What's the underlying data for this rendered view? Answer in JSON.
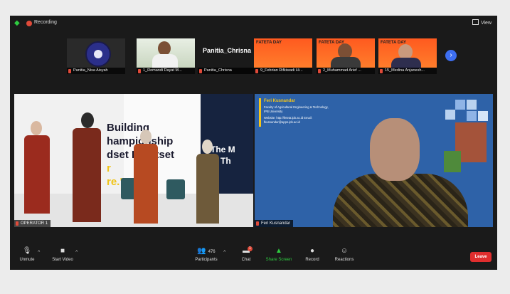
{
  "topbar": {
    "recording_label": "Recording",
    "view_label": "View"
  },
  "thumbnails": [
    {
      "name": "Panitia_Nisa Aisyah"
    },
    {
      "name": "1_Romandi Dayat M..."
    },
    {
      "name": "Panitia_Chrisna",
      "big_label": "Panitia_Chrisna"
    },
    {
      "name": "9_Febrian Rifkiwadi Hi...",
      "banner": "FATETA DAY"
    },
    {
      "name": "2_Muhammad Arief ...",
      "banner": "FATETA DAY"
    },
    {
      "name": "15_Medina Anjanesh...",
      "banner": "FATETA DAY"
    }
  ],
  "panels": {
    "left": {
      "name": "OPERATOR 1",
      "wall_line1": "Building",
      "wall_line2": "hampionship",
      "wall_line3": "dset Heartset",
      "wall_line4": "r",
      "wall_line5": "re.\"",
      "dark_wall_line1": "The M",
      "dark_wall_line2": "in Th"
    },
    "right": {
      "name": "Feri Kusnandar",
      "card_title": "Feri Kusnandar",
      "card_affiliation": "Faculty of Agricultural Engineering & Technology, IPB University",
      "card_contact": "Website: http://feteta.ipb.ac.id Email: fkusnandar@apps.ipb.ac.id"
    }
  },
  "toolbar": {
    "unmute": "Unmute",
    "start_video": "Start Video",
    "participants": "Participants",
    "participants_count": "476",
    "chat": "Chat",
    "chat_badge": "1",
    "share_screen": "Share Screen",
    "record": "Record",
    "reactions": "Reactions",
    "leave": "Leave"
  },
  "colors": {
    "share_accent": "#2ecc40",
    "leave_button": "#e02e2e",
    "recording_dot": "#e04a39",
    "brand_blue": "#2e62a8"
  }
}
